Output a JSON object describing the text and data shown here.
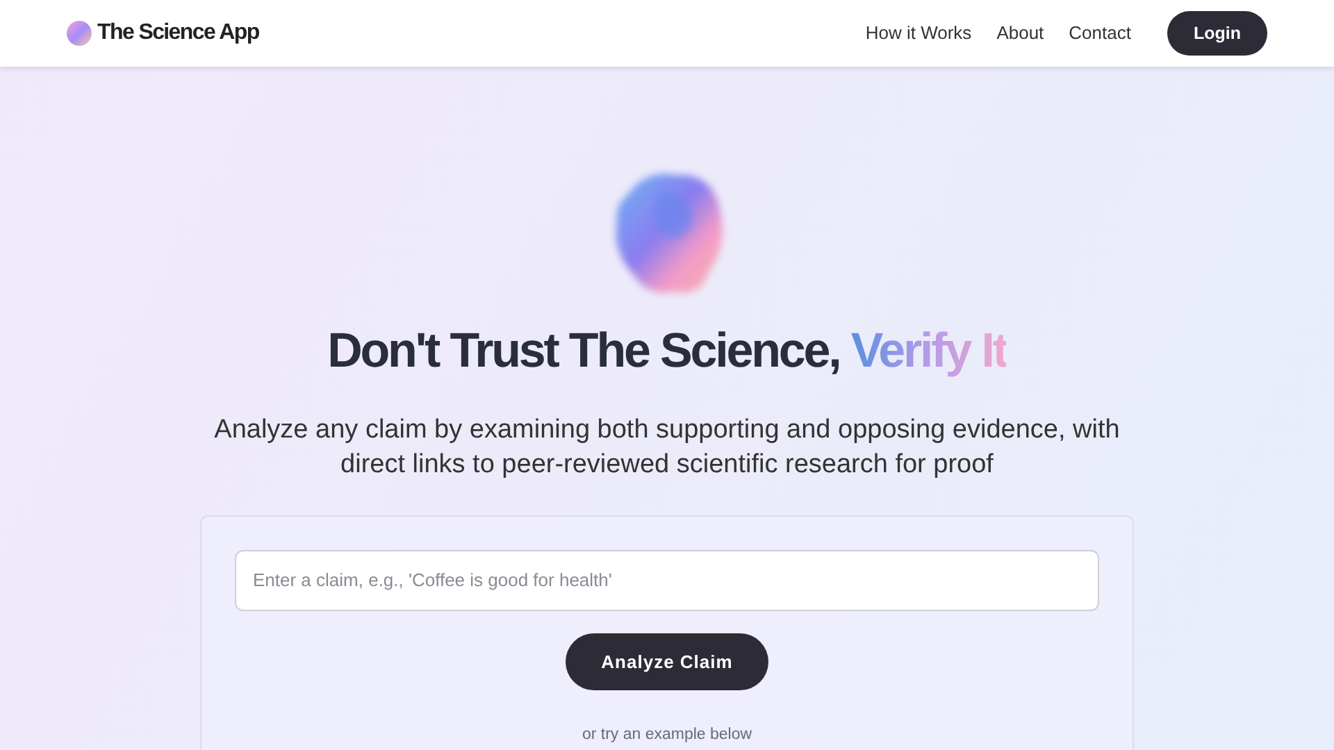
{
  "navbar": {
    "brand": "The Science App",
    "links": [
      "How it Works",
      "About",
      "Contact"
    ],
    "login": "Login"
  },
  "hero": {
    "headline": "Don't Trust The Science,",
    "headline_accent": "Verify It",
    "subtitle": "Analyze any claim by examining both supporting and opposing evidence, with direct links to peer-reviewed scientific research for proof"
  },
  "claim_form": {
    "placeholder": "Enter a claim, e.g., 'Coffee is good for health'",
    "button": "Analyze Claim",
    "hint": "or try an example below"
  }
}
